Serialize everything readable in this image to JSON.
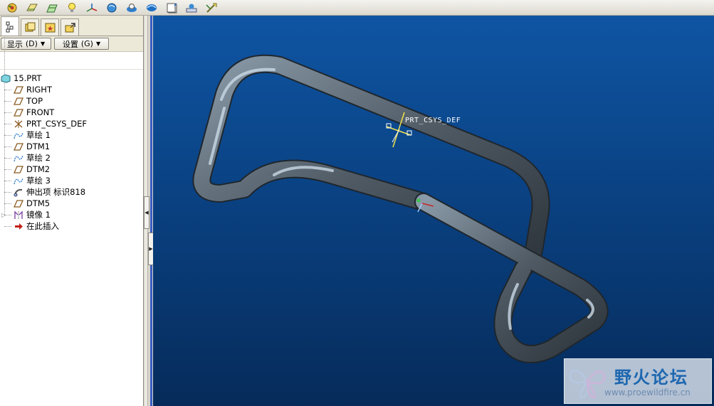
{
  "toolbar": {
    "buttons": [
      {
        "name": "spin-center-icon"
      },
      {
        "name": "datum-planes-icon"
      },
      {
        "name": "datum-axes-icon"
      },
      {
        "name": "light-bulb-icon"
      },
      {
        "name": "csys-display-icon"
      },
      {
        "name": "appearance-icon"
      },
      {
        "name": "model-color-icon"
      },
      {
        "name": "shade-icon"
      },
      {
        "name": "view-orient-icon"
      },
      {
        "name": "saved-views-icon"
      },
      {
        "name": "repaint-icon"
      }
    ]
  },
  "panel": {
    "tabs": [
      "model-tree-icon",
      "folder-browser-icon",
      "favorites-icon",
      "connections-icon"
    ],
    "show_label": "显示",
    "show_key": "(D)",
    "settings_label": "设置",
    "settings_key": "(G)"
  },
  "tree": {
    "root": "15.PRT",
    "items": [
      {
        "label": "RIGHT",
        "icon": "datum-plane-icon"
      },
      {
        "label": "TOP",
        "icon": "datum-plane-icon"
      },
      {
        "label": "FRONT",
        "icon": "datum-plane-icon"
      },
      {
        "label": "PRT_CSYS_DEF",
        "icon": "csys-icon"
      },
      {
        "label": "草绘 1",
        "icon": "sketch-icon"
      },
      {
        "label": "DTM1",
        "icon": "datum-plane-icon"
      },
      {
        "label": "草绘 2",
        "icon": "sketch-icon"
      },
      {
        "label": "DTM2",
        "icon": "datum-plane-icon"
      },
      {
        "label": "草绘 3",
        "icon": "sketch-icon"
      },
      {
        "label": "伸出项 标识818",
        "icon": "sweep-icon"
      },
      {
        "label": "DTM5",
        "icon": "datum-plane-icon"
      },
      {
        "label": "镜像 1",
        "icon": "mirror-icon"
      },
      {
        "label": "在此插入",
        "icon": "insert-here-arrow-icon"
      }
    ]
  },
  "viewport": {
    "csys_label": "PRT_CSYS_DEF",
    "background_top": "#0f55a3",
    "background_bottom": "#062b5a"
  },
  "watermark": {
    "title": "野火论坛",
    "url": "www.proewildfire.cn"
  }
}
